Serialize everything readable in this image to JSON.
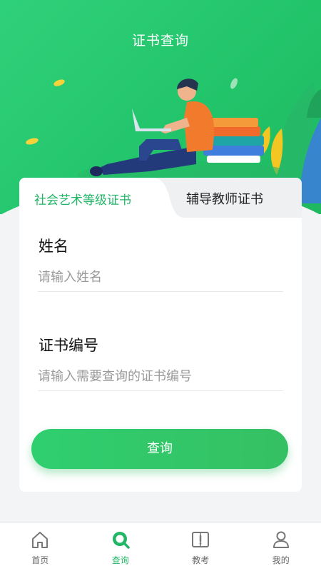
{
  "header": {
    "title": "证书查询"
  },
  "tabs": [
    {
      "label": "社会艺术等级证书",
      "active": true
    },
    {
      "label": "辅导教师证书",
      "active": false
    }
  ],
  "form": {
    "name_label": "姓名",
    "name_placeholder": "请输入姓名",
    "cert_label": "证书编号",
    "cert_placeholder": "请输入需要查询的证书编号",
    "submit_label": "查询"
  },
  "bottom_nav": [
    {
      "label": "首页",
      "icon": "home-icon",
      "active": false
    },
    {
      "label": "查询",
      "icon": "search-icon",
      "active": true
    },
    {
      "label": "教考",
      "icon": "book-icon",
      "active": false
    },
    {
      "label": "我的",
      "icon": "user-icon",
      "active": false
    }
  ],
  "colors": {
    "accent": "#21b566",
    "hero": "#2ccb73",
    "background": "#f2f4f6"
  }
}
